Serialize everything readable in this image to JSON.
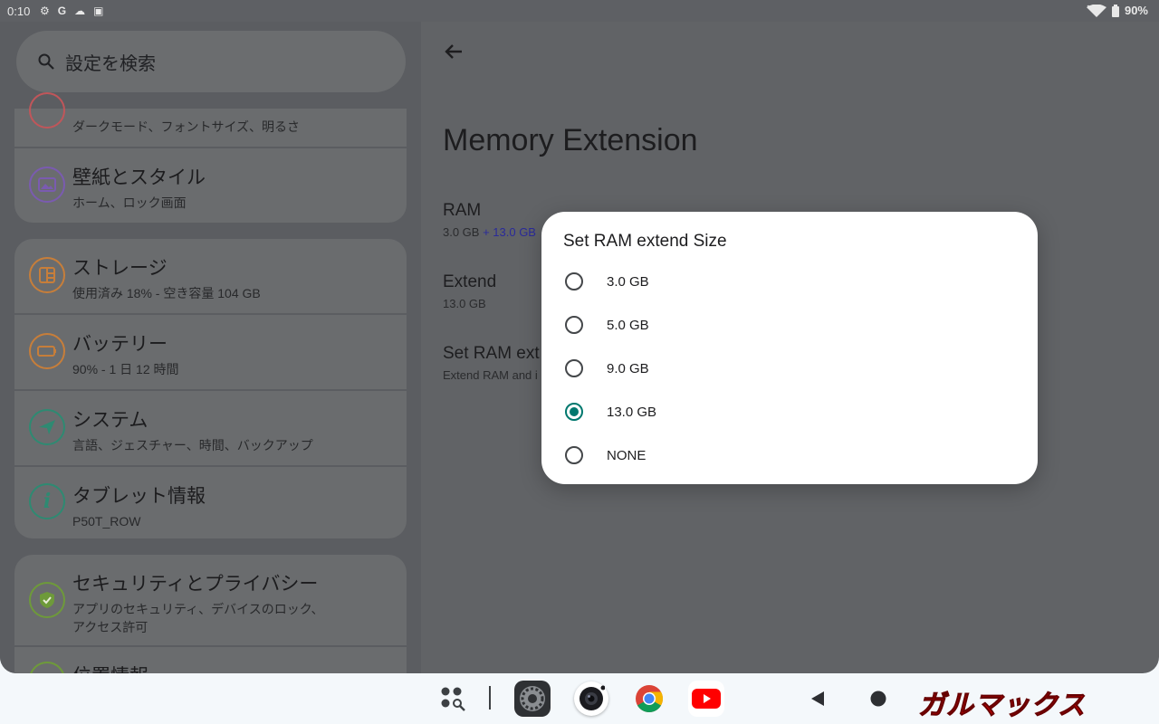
{
  "status_bar": {
    "time": "0:10",
    "battery": "90%",
    "icons": [
      "gear-icon",
      "google-icon",
      "cloud-icon",
      "card-icon",
      "wifi-icon",
      "battery-icon"
    ]
  },
  "settings_list": {
    "search_placeholder": "設定を検索",
    "partial_top_subtitle": "ダークモード、フォントサイズ、明るさ",
    "items": [
      {
        "title": "壁紙とスタイル",
        "subtitle": "ホーム、ロック画面",
        "icon": "wallpaper-icon",
        "color": "#7a5bb0"
      },
      {
        "title": "ストレージ",
        "subtitle": "使用済み 18% - 空き容量 104 GB",
        "icon": "storage-icon",
        "color": "#c77e3a"
      },
      {
        "title": "バッテリー",
        "subtitle": "90% - 1 日 12 時間",
        "icon": "battery-icon",
        "color": "#c77e3a"
      },
      {
        "title": "システム",
        "subtitle": "言語、ジェスチャー、時間、バックアップ",
        "icon": "send-icon",
        "color": "#2e8a72"
      },
      {
        "title": "タブレット情報",
        "subtitle": "P50T_ROW",
        "icon": "info-icon",
        "color": "#2e8a72"
      },
      {
        "title": "セキュリティとプライバシー",
        "subtitle": "アプリのセキュリティ、デバイスのロック、",
        "subtitle2": "アクセス許可",
        "icon": "shield-icon",
        "color": "#6e9a3a"
      },
      {
        "title": "位置情報",
        "icon": "location-icon",
        "color": "#6e9a3a"
      }
    ]
  },
  "detail": {
    "title": "Memory Extension",
    "ram": {
      "label": "RAM",
      "value_a": "3.0 GB",
      "value_b": " + 13.0 GB"
    },
    "extend": {
      "label": "Extend",
      "value": "13.0 GB"
    },
    "set_ram": {
      "label": "Set RAM ext",
      "subtitle": "Extend RAM and i"
    }
  },
  "dialog": {
    "title": "Set RAM extend Size",
    "options": [
      "3.0 GB",
      "5.0 GB",
      "9.0 GB",
      "13.0 GB",
      "NONE"
    ],
    "selected": "13.0 GB",
    "accent_color": "#00786e"
  },
  "taskbar": {
    "apps": [
      "app-drawer-icon",
      "settings-app-icon",
      "camera-app-icon",
      "chrome-app-icon",
      "youtube-app-icon"
    ],
    "nav": [
      "back-icon",
      "home-icon"
    ],
    "watermark": "ガルマックス"
  }
}
